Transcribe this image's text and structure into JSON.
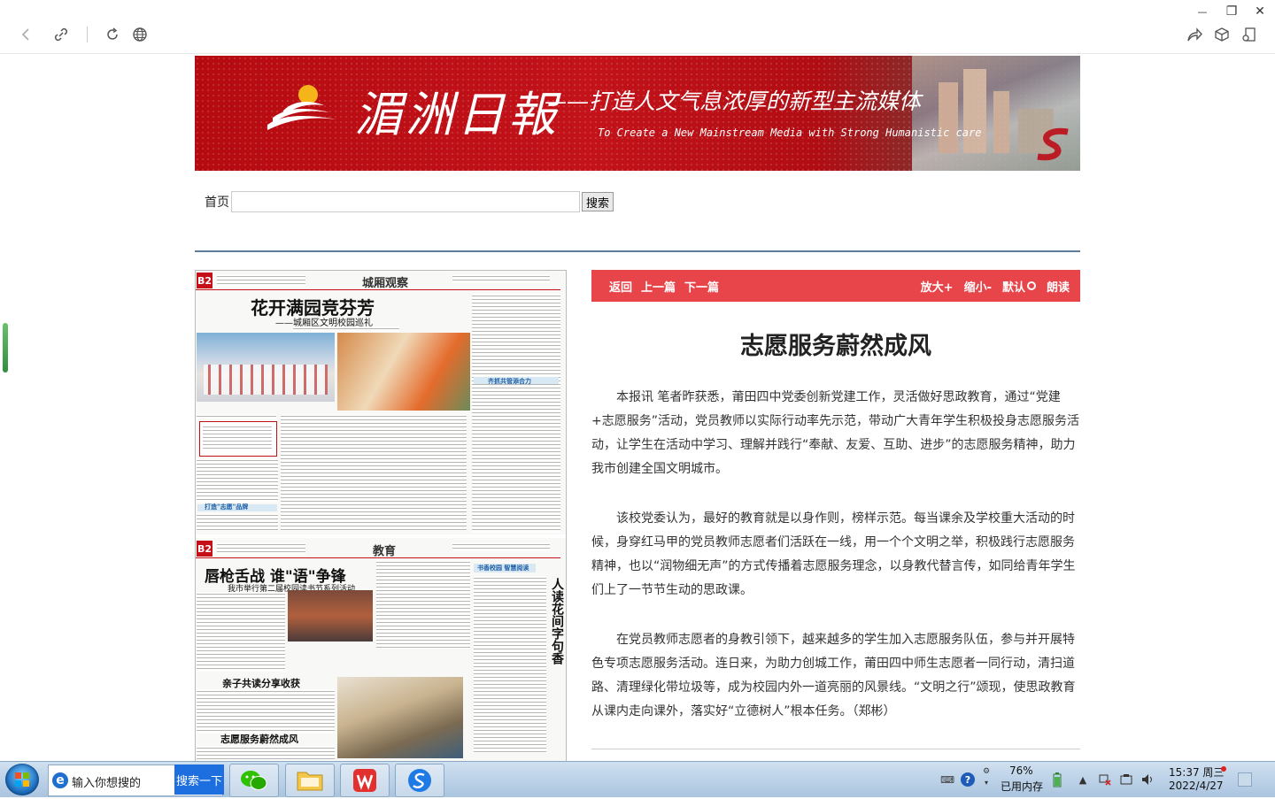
{
  "window": {
    "minimize_glyph": "—",
    "maximize_glyph": "❐",
    "close_glyph": "✕"
  },
  "banner": {
    "logo_text": "湄洲日報",
    "slogan": "——打造人文气息浓厚的新型主流媒体",
    "slogan_en": "To Create a New Mainstream Media with Strong Humanistic care"
  },
  "search": {
    "home_label": "首页",
    "input_value": "",
    "button_label": "搜索"
  },
  "newspaper": {
    "top": {
      "page_tag": "B2",
      "section": "城厢观察",
      "headline": "花开满园竞芬芳",
      "subhead": "——城厢区文明校园巡礼",
      "subsection": "齐抓共管添合力",
      "box_title": "打造\"志愿\"品牌"
    },
    "bottom": {
      "page_tag": "B2",
      "section": "教育",
      "headline": "唇枪舌战 谁\"语\"争锋",
      "subhead": "我市举行第二届校园读书节系列活动",
      "sub1": "亲子共读分享收获",
      "sub2": "志愿服务蔚然成风",
      "side_box": "书香校园 智慧阅读",
      "vertical": "人读花间字句香"
    }
  },
  "article": {
    "toolbar": {
      "back": "返回",
      "prev": "上一篇",
      "next": "下一篇",
      "zoom_in": "放大+",
      "zoom_out": "缩小-",
      "default": "默认",
      "read": "朗读"
    },
    "title": "志愿服务蔚然成风",
    "paragraphs": [
      "本报讯 笔者昨获悉，莆田四中党委创新党建工作，灵活做好思政教育，通过“党建+志愿服务”活动，党员教师以实际行动率先示范，带动广大青年学生积极投身志愿服务活动，让学生在活动中学习、理解并践行“奉献、友爱、互助、进步”的志愿服务精神，助力我市创建全国文明城市。",
      "该校党委认为，最好的教育就是以身作则，榜样示范。每当课余及学校重大活动的时候，身穿红马甲的党员教师志愿者们活跃在一线，用一个个文明之举，积极践行志愿服务精神，也以“润物细无声”的方式传播着志愿服务理念，以身教代替言传，如同给青年学生们上了一节节生动的思政课。",
      "在党员教师志愿者的身教引领下，越来越多的学生加入志愿服务队伍，参与并开展特色专项志愿服务活动。连日来，为助力创城工作，莆田四中师生志愿者一同行动，清扫道路、清理绿化带垃圾等，成为校园内外一道亮丽的风景线。“文明之行”颂现，使思政教育从课内走向课外，落实好“立德树人”根本任务。（郑彬）"
    ]
  },
  "taskbar": {
    "search_placeholder": "输入你想搜的",
    "search_button": "搜索一下",
    "memory_percent": "76%",
    "memory_label": "已用内存",
    "time": "15:37 周三",
    "date": "2022/4/27"
  },
  "colors": {
    "banner_red": "#c3121a",
    "toolbar_red": "#e8454b",
    "divider_blue": "#5c7c99"
  },
  "icons": [
    "back-icon",
    "link-icon",
    "refresh-icon",
    "globe-icon",
    "share-icon",
    "cube-icon",
    "reader-icon"
  ]
}
